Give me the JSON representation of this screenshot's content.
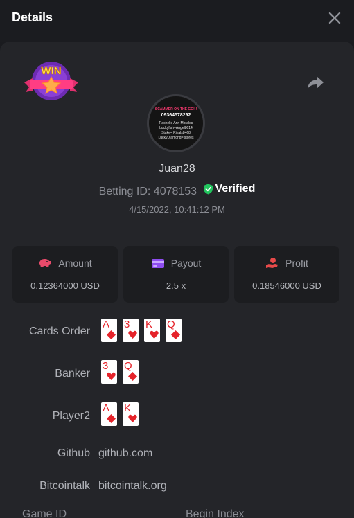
{
  "header": {
    "title": "Details",
    "close_icon": "close-icon"
  },
  "bet": {
    "username": "Juan28",
    "betting_id_text": "Betting ID: 4078153",
    "verified_label": "Verified",
    "timestamp": "4/15/2022, 10:41:12 PM",
    "badge_text": "WIN"
  },
  "avatar_lines": {
    "l1": "SCAMMER ON THE GO!!!",
    "l2": "09364578292",
    "l3": "Rachelle Ann Morales",
    "l4": "Luckyfish=Angel8014",
    "l5": "Stake= Rizals8468",
    "l6": "LuckyDiamond= stores"
  },
  "stats": {
    "amount": {
      "label": "Amount",
      "value": "0.12364000 USD",
      "icon": "pig-icon"
    },
    "payout": {
      "label": "Payout",
      "value": "2.5 x",
      "icon": "card-icon"
    },
    "profit": {
      "label": "Profit",
      "value": "0.18546000 USD",
      "icon": "hand-coin-icon"
    }
  },
  "rows": {
    "cards_order": {
      "label": "Cards Order",
      "cards": [
        {
          "rank": "A",
          "suit": "diamond"
        },
        {
          "rank": "3",
          "suit": "heart"
        },
        {
          "rank": "K",
          "suit": "heart"
        },
        {
          "rank": "Q",
          "suit": "diamond"
        }
      ]
    },
    "banker": {
      "label": "Banker",
      "cards": [
        {
          "rank": "3",
          "suit": "heart"
        },
        {
          "rank": "Q",
          "suit": "diamond"
        }
      ]
    },
    "player2": {
      "label": "Player2",
      "cards": [
        {
          "rank": "A",
          "suit": "diamond"
        },
        {
          "rank": "K",
          "suit": "heart"
        }
      ]
    },
    "github": {
      "label": "Github",
      "value": "github.com"
    },
    "bitcointalk": {
      "label": "Bitcointalk",
      "value": "bitcointalk.org"
    }
  },
  "bottom": {
    "game_id_label": "Game ID",
    "begin_index_label": "Begin Index"
  },
  "colors": {
    "accent_green": "#22c55e",
    "card_red": "#e5232a",
    "panel": "#242529",
    "header": "#1b1c20"
  }
}
